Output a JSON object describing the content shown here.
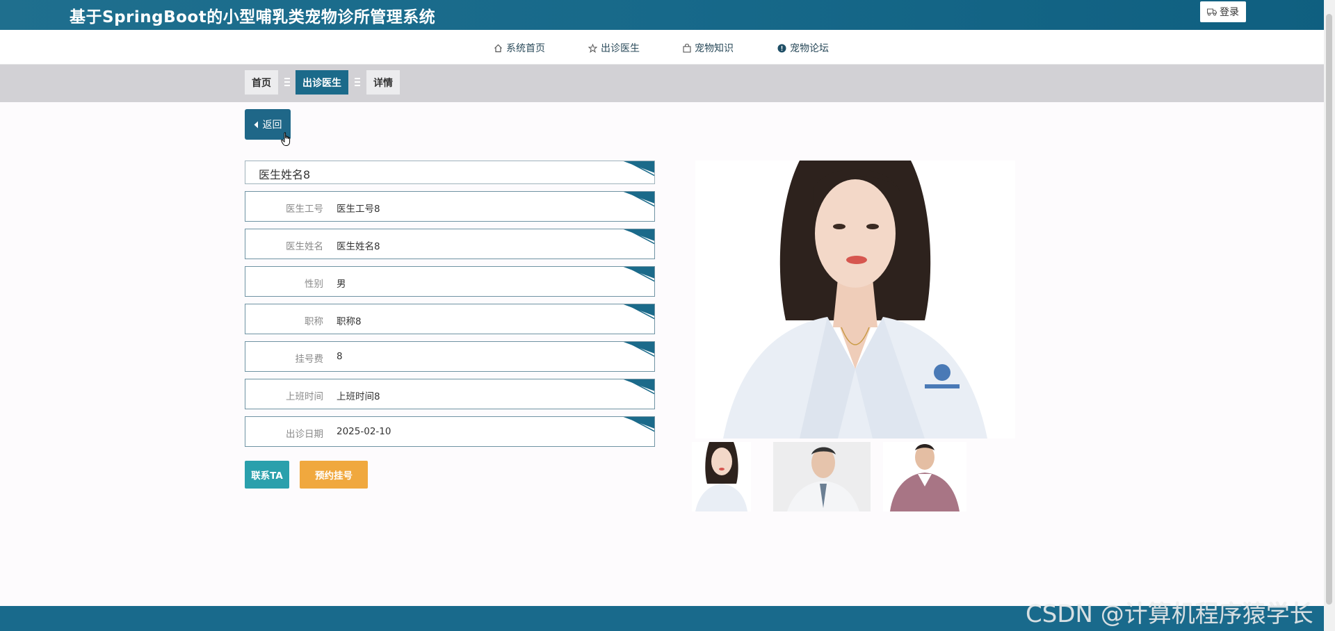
{
  "header": {
    "site_title": "基于SpringBoot的小型哺乳类宠物诊所管理系统",
    "login_label": "登录"
  },
  "nav": {
    "items": [
      {
        "label": "系统首页",
        "icon": "home-icon"
      },
      {
        "label": "出诊医生",
        "icon": "star-icon"
      },
      {
        "label": "宠物知识",
        "icon": "bag-icon"
      },
      {
        "label": "宠物论坛",
        "icon": "info-icon"
      }
    ]
  },
  "breadcrumb": {
    "items": [
      "首页",
      "出诊医生",
      "详情"
    ]
  },
  "back_label": "返回",
  "detail": {
    "title": "医生姓名8",
    "fields": [
      {
        "label": "医生工号",
        "value": "医生工号8"
      },
      {
        "label": "医生姓名",
        "value": "医生姓名8"
      },
      {
        "label": "性别",
        "value": "男"
      },
      {
        "label": "职称",
        "value": "职称8"
      },
      {
        "label": "挂号费",
        "value": "8"
      },
      {
        "label": "上班时间",
        "value": "上班时间8"
      },
      {
        "label": "出诊日期",
        "value": "2025-02-10"
      }
    ]
  },
  "actions": {
    "contact_label": "联系TA",
    "book_label": "预约挂号"
  },
  "watermark": "CSDN @计算机程序猿学长",
  "colors": {
    "primary": "#1b6a8a",
    "contact": "#2aa0ac",
    "book": "#f0a83e"
  }
}
